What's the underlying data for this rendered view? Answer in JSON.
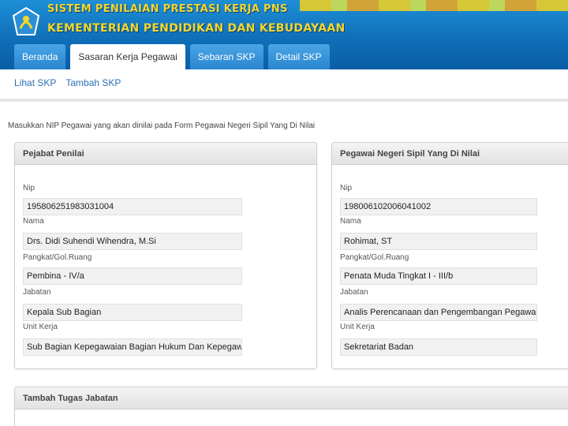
{
  "header": {
    "title_line1": "SISTEM PENILAIAN PRESTASI KERJA PNS",
    "title_line2": "KEMENTERIAN PENDIDIKAN DAN KEBUDAYAAN",
    "colors": {
      "header_blue": "#0f6fb8",
      "title_yellow": "#f4d62b"
    }
  },
  "tabs": [
    {
      "label": "Beranda"
    },
    {
      "label": "Sasaran Kerja Pegawai",
      "active": true
    },
    {
      "label": "Sebaran SKP"
    },
    {
      "label": "Detail SKP"
    }
  ],
  "subnav": {
    "lihat": "Lihat SKP",
    "tambah": "Tambah SKP"
  },
  "instruction": "Masukkan NIP Pegawai yang akan dinilai pada Form Pegawai Negeri Sipil Yang Di Nilai",
  "pejabat": {
    "heading": "Pejabat Penilai",
    "nip_label": "Nip",
    "nip": "195806251983031004",
    "nama_label": "Nama",
    "nama": "Drs. Didi Suhendi Wihendra, M.Si",
    "pangkat_label": "Pangkat/Gol.Ruang",
    "pangkat": "Pembina - IV/a",
    "jabatan_label": "Jabatan",
    "jabatan": "Kepala Sub Bagian",
    "unit_label": "Unit Kerja",
    "unit": "Sub Bagian Kepegawaian Bagian Hukum Dan Kepegawaian Sekr"
  },
  "pegawai": {
    "heading": "Pegawai Negeri Sipil Yang Di Nilai",
    "nip_label": "Nip",
    "nip": "198006102006041002",
    "nama_label": "Nama",
    "nama": "Rohimat, ST",
    "pangkat_label": "Pangkat/Gol.Ruang",
    "pangkat": "Penata Muda Tingkat I - III/b",
    "jabatan_label": "Jabatan",
    "jabatan": "Analis Perencanaan dan Pengembangan Pegawai",
    "unit_label": "Unit Kerja",
    "unit": "Sekretariat Badan"
  },
  "tugas": {
    "heading": "Tambah Tugas Jabatan"
  }
}
